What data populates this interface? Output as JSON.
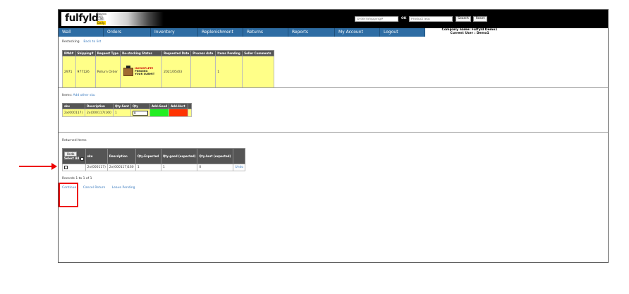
{
  "header": {
    "logo_word": "fulfyld",
    "logo_tag": [
      "Source.",
      "Pack.",
      "Fulfill."
    ],
    "logo_tag_highlight": "Daily.",
    "order_search_placeholder": "Order/Shipping#",
    "ok_label": "OK",
    "sku_search_placeholder": "Product Sku",
    "search_label": "Search",
    "reset_label": "Reset"
  },
  "nav": {
    "items": [
      "Wall",
      "Orders",
      "Inventory",
      "Replenishment",
      "Returns",
      "Reports",
      "My Account",
      "Logout"
    ]
  },
  "company": {
    "name_line": "Company name: Fulfyld Demo1",
    "user_line": "Current User : Demo1"
  },
  "breadcrumb": {
    "label": "Restocking",
    "back_link": "Back to list"
  },
  "rma_table": {
    "headers": [
      "RMA#",
      "Shipping#",
      "Request Type",
      "Re-stocking Status",
      "Requested Date",
      "Process date",
      "Items Pending",
      "Seller Comments"
    ],
    "row": {
      "rma": "2971",
      "shipping": "977126",
      "request_type": "Return Order",
      "status_lines": [
        "INCOMPLETE",
        "PENDING",
        "YOUR SUBMIT"
      ],
      "requested_date": "2021/05/03",
      "process_date": "",
      "items_pending": "1",
      "seller_comments": ""
    }
  },
  "items_section": {
    "label": "Items:",
    "add_link": "Add other sku",
    "headers": [
      "sku",
      "Description",
      "Qty-Sent",
      "Qty",
      "Add-Good",
      "Add-Hurt"
    ],
    "row": {
      "sku": "2x(000117)",
      "description": "2x(000117)160",
      "qty_sent": "1",
      "qty": "0"
    }
  },
  "returned_section": {
    "label": "Returned Items",
    "undo_label": "Undo",
    "select_all_label": "Select All",
    "headers": [
      "sku",
      "Description",
      "Qty-Expected",
      "Qty-good (expected)",
      "Qty-hurt (expected)"
    ],
    "row": {
      "sku": "2x(000117)",
      "description": "2x(000117)160",
      "qty_expected": "1",
      "qty_good": "1",
      "qty_hurt": "0",
      "undo_link": "Undo"
    }
  },
  "records_text": "Records 1 to 1 of 1",
  "actions": {
    "continue": "Continue",
    "cancel_return": "Cancel Return",
    "leave_pending": "Leave Pending"
  },
  "colors": {
    "nav_blue": "#2e6da4",
    "row_yellow": "#ffff88",
    "add_good": "#22ee22",
    "add_hurt": "#ff3300",
    "annotation_red": "#ee0000"
  }
}
